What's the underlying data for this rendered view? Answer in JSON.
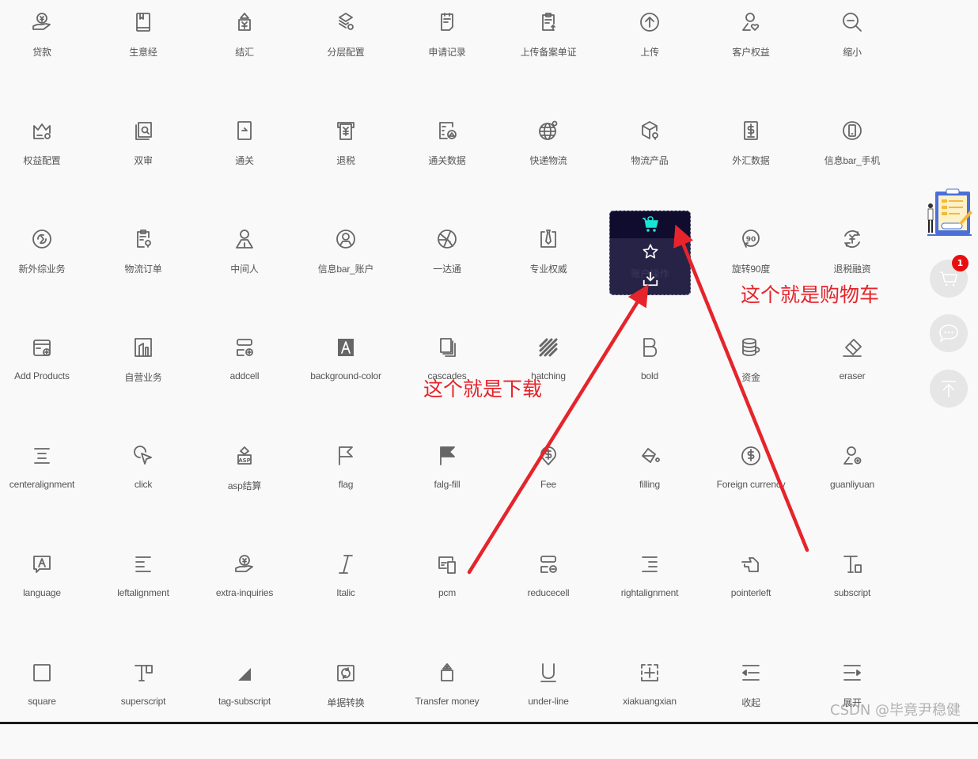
{
  "icons": [
    {
      "label": "贷款",
      "icon": "loan-hand-coin-icon"
    },
    {
      "label": "生意经",
      "icon": "book-icon"
    },
    {
      "label": "结汇",
      "icon": "price-tag-yuan-icon"
    },
    {
      "label": "分层配置",
      "icon": "layers-settings-icon"
    },
    {
      "label": "申请记录",
      "icon": "clipboard-document-icon"
    },
    {
      "label": "上传备案单证",
      "icon": "clipboard-upload-icon"
    },
    {
      "label": "上传",
      "icon": "circle-arrow-up-icon"
    },
    {
      "label": "客户权益",
      "icon": "user-heart-icon"
    },
    {
      "label": "缩小",
      "icon": "zoom-out-icon"
    },
    {
      "label": "权益配置",
      "icon": "crown-settings-icon"
    },
    {
      "label": "双审",
      "icon": "double-review-search-icon"
    },
    {
      "label": "通关",
      "icon": "customs-pass-icon"
    },
    {
      "label": "退税",
      "icon": "tax-refund-machine-icon"
    },
    {
      "label": "通关数据",
      "icon": "customs-data-icon"
    },
    {
      "label": "快递物流",
      "icon": "globe-location-icon"
    },
    {
      "label": "物流产品",
      "icon": "box-location-icon"
    },
    {
      "label": "外汇数据",
      "icon": "dollar-document-icon"
    },
    {
      "label": "信息bar_手机",
      "icon": "mobile-circle-icon"
    },
    {
      "label": "新外综业务",
      "icon": "new-trade-circle-icon"
    },
    {
      "label": "物流订单",
      "icon": "clipboard-location-icon"
    },
    {
      "label": "中间人",
      "icon": "person-icon"
    },
    {
      "label": "信息bar_账户",
      "icon": "user-circle-icon"
    },
    {
      "label": "一达通",
      "icon": "onetouch-logo-icon"
    },
    {
      "label": "专业权威",
      "icon": "tie-icon"
    },
    {
      "label": "账户操作",
      "icon": "account-operation-icon"
    },
    {
      "label": "旋转90度",
      "icon": "rotate-90-icon"
    },
    {
      "label": "退税融资",
      "icon": "yuan-refresh-icon"
    },
    {
      "label": "Add Products",
      "icon": "card-add-icon"
    },
    {
      "label": "自营业务",
      "icon": "building-icon"
    },
    {
      "label": "addcell",
      "icon": "cell-add-icon"
    },
    {
      "label": "background-color",
      "icon": "letter-a-filled-icon"
    },
    {
      "label": "cascades",
      "icon": "cascade-pages-icon"
    },
    {
      "label": "hatching",
      "icon": "hatching-icon"
    },
    {
      "label": "bold",
      "icon": "bold-b-icon"
    },
    {
      "label": "资金",
      "icon": "coin-stack-icon"
    },
    {
      "label": "eraser",
      "icon": "eraser-icon"
    },
    {
      "label": "centeralignment",
      "icon": "align-center-icon"
    },
    {
      "label": "click",
      "icon": "cursor-click-icon"
    },
    {
      "label": "asp结算",
      "icon": "asp-tag-icon"
    },
    {
      "label": "flag",
      "icon": "flag-outline-icon"
    },
    {
      "label": "falg-fill",
      "icon": "flag-filled-icon"
    },
    {
      "label": "Fee",
      "icon": "dollar-pin-icon"
    },
    {
      "label": "filling",
      "icon": "paint-bucket-icon"
    },
    {
      "label": "Foreign currency",
      "icon": "dollar-circle-icon"
    },
    {
      "label": "guanliyuan",
      "icon": "admin-user-icon"
    },
    {
      "label": "language",
      "icon": "language-bubble-icon"
    },
    {
      "label": "leftalignment",
      "icon": "align-left-icon"
    },
    {
      "label": "extra-inquiries",
      "icon": "hand-coin-icon"
    },
    {
      "label": "Italic",
      "icon": "italic-icon"
    },
    {
      "label": "pcm",
      "icon": "devices-icon"
    },
    {
      "label": "reducecell",
      "icon": "cell-remove-icon"
    },
    {
      "label": "rightalignment",
      "icon": "align-right-icon"
    },
    {
      "label": "pointerleft",
      "icon": "hand-pointer-left-icon"
    },
    {
      "label": "subscript",
      "icon": "subscript-icon"
    },
    {
      "label": "square",
      "icon": "square-icon"
    },
    {
      "label": "superscript",
      "icon": "superscript-icon"
    },
    {
      "label": "tag-subscript",
      "icon": "triangle-corner-icon"
    },
    {
      "label": "单据转换",
      "icon": "document-convert-icon"
    },
    {
      "label": "Transfer money",
      "icon": "transfer-money-tag-icon"
    },
    {
      "label": "under-line",
      "icon": "underline-icon"
    },
    {
      "label": "xiakuangxian",
      "icon": "dashed-border-icon"
    },
    {
      "label": "收起",
      "icon": "indent-collapse-icon"
    },
    {
      "label": "展开",
      "icon": "indent-expand-icon"
    }
  ],
  "popup": {
    "items": [
      "cart",
      "star",
      "download"
    ],
    "ghost_label": "账户操作",
    "cart_color": "#17e6d4"
  },
  "sidebar": {
    "cart_badge": "1",
    "illustration_text": "快来看看"
  },
  "annotations": {
    "download_note": "这个就是下载",
    "cart_note": "这个就是购物车",
    "color": "#e5242b"
  },
  "watermark": "CSDN @毕竟尹稳健"
}
